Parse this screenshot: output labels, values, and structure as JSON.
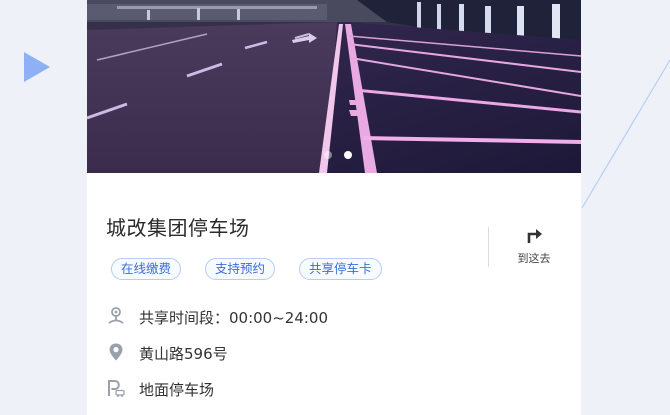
{
  "colors": {
    "page_bg": "#eef1f8",
    "accent": "#3a6ed8",
    "tag_border": "#b6ccf2",
    "icon_gray": "#9aa1ac",
    "decor_blue": "#8fb0f5"
  },
  "carousel": {
    "total_slides": 2,
    "active_index": 1
  },
  "parking": {
    "name": "城改集团停车场",
    "tags": [
      "在线缴费",
      "支持预约",
      "共享停车卡"
    ],
    "navigate": {
      "label": "到这去",
      "icon": "turn-right-arrow-icon"
    },
    "info": [
      {
        "icon": "shared-time-icon",
        "text": "共享时间段：00:00~24:00"
      },
      {
        "icon": "location-pin-icon",
        "text": "黄山路596号"
      },
      {
        "icon": "parking-type-icon",
        "text": "地面停车场"
      }
    ]
  }
}
